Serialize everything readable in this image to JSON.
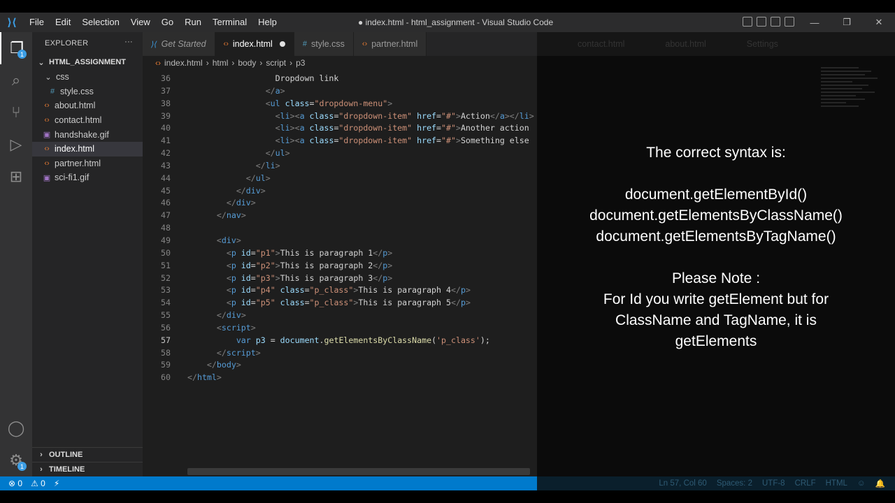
{
  "app": {
    "window_title": "● index.html - html_assignment - Visual Studio Code",
    "menu": [
      "File",
      "Edit",
      "Selection",
      "View",
      "Go",
      "Run",
      "Terminal",
      "Help"
    ],
    "window_controls": [
      "—",
      "❐",
      "✕"
    ]
  },
  "activity_bar": {
    "explorer_badge": "1",
    "settings_badge": "1"
  },
  "sidebar": {
    "title": "EXPLORER",
    "more": "···",
    "folder": "HTML_ASSIGNMENT",
    "subfolder": "css",
    "files": [
      {
        "name": "style.css",
        "type": "css"
      },
      {
        "name": "about.html",
        "type": "html"
      },
      {
        "name": "contact.html",
        "type": "html"
      },
      {
        "name": "handshake.gif",
        "type": "gif"
      },
      {
        "name": "index.html",
        "type": "html"
      },
      {
        "name": "partner.html",
        "type": "html"
      },
      {
        "name": "sci-fi1.gif",
        "type": "gif"
      }
    ],
    "outline": "OUTLINE",
    "timeline": "TIMELINE"
  },
  "tabs": [
    {
      "label": "Get Started"
    },
    {
      "label": "index.html"
    },
    {
      "label": "style.css"
    },
    {
      "label": "partner.html"
    },
    {
      "label": "contact.html"
    },
    {
      "label": "about.html"
    },
    {
      "label": "Settings"
    }
  ],
  "breadcrumb": [
    "index.html",
    "html",
    "body",
    "script",
    "p3"
  ],
  "editor": {
    "line_numbers": [
      "36",
      "37",
      "38",
      "39",
      "40",
      "41",
      "42",
      "43",
      "44",
      "45",
      "46",
      "47",
      "48",
      "49",
      "50",
      "51",
      "52",
      "53",
      "54",
      "55",
      "56",
      "57",
      "58",
      "59",
      "60"
    ],
    "current_line": "57"
  },
  "overlay": {
    "heading": "The correct syntax is:",
    "syntax": [
      "document.getElementById()",
      "document.getElementsByClassName()",
      "document.getElementsByTagName()"
    ],
    "note_title": "Please Note :",
    "note_lines": [
      "For Id you write getElement but for",
      "ClassName and TagName, it is",
      "getElements"
    ]
  },
  "status": {
    "errors": "⊗ 0",
    "warnings": "⚠ 0",
    "position": "Ln 57, Col 60",
    "spaces": "Spaces: 2",
    "encoding": "UTF-8",
    "eol": "CRLF",
    "language": "HTML"
  }
}
